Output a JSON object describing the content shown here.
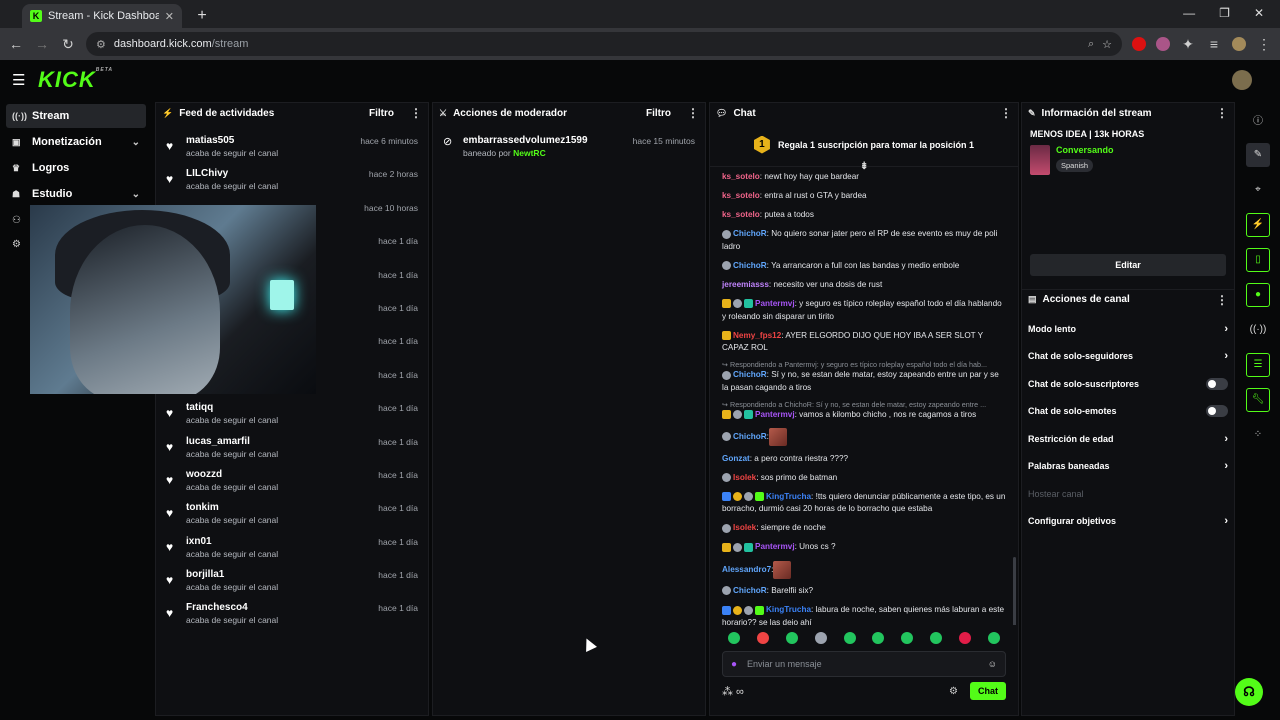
{
  "browser": {
    "tab_title": "Stream - Kick Dashboard",
    "tab_favicon": "K",
    "url_host": "dashboard.kick.com",
    "url_path": "/stream"
  },
  "header": {
    "logo": "KICK",
    "logo_tag": "BETA"
  },
  "nav": {
    "items": [
      {
        "label": "Stream",
        "icon": "broadcast-icon"
      },
      {
        "label": "Monetización",
        "icon": "money-icon"
      },
      {
        "label": "Logros",
        "icon": "trophy-icon"
      },
      {
        "label": "Estudio",
        "icon": "studio-icon"
      }
    ]
  },
  "feed": {
    "title": "Feed de actividades",
    "filter": "Filtro",
    "items": [
      {
        "name": "matias505",
        "sub": "acaba de seguir el canal",
        "time": "hace 6 minutos"
      },
      {
        "name": "LILChivy",
        "sub": "acaba de seguir el canal",
        "time": "hace 2 horas"
      },
      {
        "name": "",
        "sub": "",
        "time": "hace 10 horas"
      },
      {
        "name": "",
        "sub": "",
        "time": "hace 1 día"
      },
      {
        "name": "",
        "sub": "",
        "time": "hace 1 día"
      },
      {
        "name": "",
        "sub": "",
        "time": "hace 1 día"
      },
      {
        "name": "",
        "sub": "",
        "time": "hace 1 día"
      },
      {
        "name": "",
        "sub": "",
        "time": "hace 1 día"
      },
      {
        "name": "tatiqq",
        "sub": "acaba de seguir el canal",
        "time": "hace 1 día"
      },
      {
        "name": "lucas_amarfil",
        "sub": "acaba de seguir el canal",
        "time": "hace 1 día"
      },
      {
        "name": "woozzd",
        "sub": "acaba de seguir el canal",
        "time": "hace 1 día"
      },
      {
        "name": "tonkim",
        "sub": "acaba de seguir el canal",
        "time": "hace 1 día"
      },
      {
        "name": "ixn01",
        "sub": "acaba de seguir el canal",
        "time": "hace 1 día"
      },
      {
        "name": "borjilla1",
        "sub": "acaba de seguir el canal",
        "time": "hace 1 día"
      },
      {
        "name": "Franchesco4",
        "sub": "acaba de seguir el canal",
        "time": "hace 1 día"
      }
    ]
  },
  "mod": {
    "title": "Acciones de moderador",
    "filter": "Filtro",
    "items": [
      {
        "name": "embarrassedvolumez1599",
        "sub_prefix": "baneado por",
        "by": "NewtRC",
        "time": "hace 15 minutos"
      }
    ]
  },
  "chat": {
    "title": "Chat",
    "pinned_number": "1",
    "pinned_text": "Regala 1 suscripción para tomar la posición 1",
    "messages": [
      {
        "user": "ks_sotelo",
        "color": "#f0648a",
        "badges": [],
        "text": ": newt hoy hay que bardear"
      },
      {
        "user": "ks_sotelo",
        "color": "#f0648a",
        "badges": [],
        "text": ": entra al rust o GTA y bardea"
      },
      {
        "user": "ks_sotelo",
        "color": "#f0648a",
        "badges": [],
        "text": ": putea a todos"
      },
      {
        "user": "ChichoR",
        "color": "#60a5fa",
        "badges": [
          "b-gray"
        ],
        "text": ": No quiero sonar jater pero el RP de ese evento es muy de poli ladro"
      },
      {
        "user": "ChichoR",
        "color": "#60a5fa",
        "badges": [
          "b-gray"
        ],
        "text": ": Ya arrancaron a full con las bandas y medio embole"
      },
      {
        "user": "jereemiasss",
        "color": "#c084fc",
        "badges": [],
        "text": ": necesito ver una dosis de rust"
      },
      {
        "user": "Pantermvj",
        "color": "#a855f7",
        "badges": [
          "b-crown",
          "b-gray",
          "b-vip"
        ],
        "text": ": y seguro es típico roleplay español todo el día hablando y roleando sin disparar un tirito"
      },
      {
        "user": "Nemy_fps12",
        "color": "#ef4444",
        "badges": [
          "b-crown"
        ],
        "text": ": AYER ELGORDO DIJO QUE HOY IBA A SER SLOT Y CAPAZ ROL"
      },
      {
        "reply": "Respondiendo a Pantermvj: y seguro es típico roleplay español todo el día hab...",
        "user": "ChichoR",
        "color": "#60a5fa",
        "badges": [
          "b-gray"
        ],
        "text": ": Sí y no, se estan dele matar, estoy zapeando entre un par y se la pasan cagando a tiros"
      },
      {
        "reply": "Respondiendo a ChichoR: Sí y no, se estan dele matar, estoy zapeando entre ...",
        "user": "Pantermvj",
        "color": "#a855f7",
        "badges": [
          "b-crown",
          "b-gray",
          "b-vip"
        ],
        "text": ": vamos a kilombo chicho , nos re cagamos a tiros"
      },
      {
        "user": "ChichoR",
        "color": "#60a5fa",
        "badges": [
          "b-gray"
        ],
        "text": ":",
        "emote": true
      },
      {
        "user": "Gonzat",
        "color": "#60a5fa",
        "badges": [],
        "text": ": a pero contra riestra ????"
      },
      {
        "user": "Isolek",
        "color": "#ef4444",
        "badges": [
          "b-gray"
        ],
        "text": ": sos primo de batman"
      },
      {
        "user": "KingTrucha",
        "color": "#3b82f6",
        "badges": [
          "b-og",
          "b-num",
          "b-gray",
          "b-green"
        ],
        "text": ": !tts quiero denunciar públicamente a este tipo, es un borracho, durmió casi 20 horas de lo borracho que estaba"
      },
      {
        "user": "Isolek",
        "color": "#ef4444",
        "badges": [
          "b-gray"
        ],
        "text": ": siempre de noche"
      },
      {
        "user": "Pantermvj",
        "color": "#a855f7",
        "badges": [
          "b-crown",
          "b-gray",
          "b-vip"
        ],
        "text": ": Unos cs ?"
      },
      {
        "user": "Alessandro7",
        "color": "#60a5fa",
        "badges": [],
        "text": ":",
        "emote": true
      },
      {
        "user": "ChichoR",
        "color": "#60a5fa",
        "badges": [
          "b-gray"
        ],
        "text": ": Barelfii six?"
      },
      {
        "user": "KingTrucha",
        "color": "#3b82f6",
        "badges": [
          "b-og",
          "b-num",
          "b-gray",
          "b-green"
        ],
        "text": ": labura de noche, saben quienes más laburan a este horario?? se las dejo ahí"
      }
    ],
    "emote_colors": [
      "#22c55e",
      "#ef4444",
      "#22c55e",
      "#9ca3af",
      "#22c55e",
      "#22c55e",
      "#22c55e",
      "#22c55e",
      "#e11d48",
      "#22c55e"
    ],
    "input_placeholder": "Enviar un mensaje",
    "send_label": "Chat"
  },
  "info": {
    "title": "Información del stream",
    "stream_title": "MENOS IDEA | 13k HORAS",
    "category": "Conversando",
    "language": "Spanish",
    "edit_label": "Editar"
  },
  "channel": {
    "title": "Acciones de canal",
    "items": [
      {
        "label": "Modo lento",
        "control": "arrow"
      },
      {
        "label": "Chat de solo-seguidores",
        "control": "arrow"
      },
      {
        "label": "Chat de solo-suscriptores",
        "control": "toggle"
      },
      {
        "label": "Chat de solo-emotes",
        "control": "toggle"
      },
      {
        "label": "Restricción de edad",
        "control": "arrow"
      },
      {
        "label": "Palabras baneadas",
        "control": "arrow"
      },
      {
        "label": "Hostear canal",
        "control": "disabled"
      },
      {
        "label": "Configurar objetivos",
        "control": "arrow"
      }
    ]
  },
  "colors": {
    "accent": "#53fc18"
  }
}
